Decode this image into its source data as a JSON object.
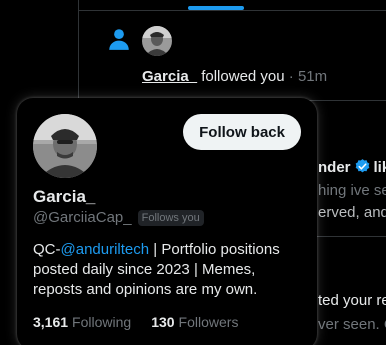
{
  "notification": {
    "name": "Garcia_",
    "action": "followed you",
    "separator": "·",
    "time": "51m"
  },
  "background_fragments": {
    "line1_name": "nder",
    "line1_action": "lik",
    "line2": "hing ive se",
    "line3": "erved, and",
    "line4": "ted your re",
    "line5": "ver seen. C"
  },
  "hover_card": {
    "follow_back_label": "Follow back",
    "name": "Garcia_",
    "handle": "@GarciiaCap_",
    "follows_you_badge": "Follows you",
    "bio_prefix": "QC-",
    "bio_mention": "@anduriltech",
    "bio_rest": " | Portfolio positions posted daily since 2023 | Memes, reposts and opinions are my own.",
    "following_count": "3,161",
    "following_label": "Following",
    "followers_count": "130",
    "followers_label": "Followers"
  },
  "colors": {
    "accent": "#1d9bf0",
    "text": "#e7e9ea",
    "muted": "#71767b",
    "background": "#000000"
  },
  "icons": {
    "notification_type": "person-icon",
    "verified": "verified-badge-icon"
  }
}
